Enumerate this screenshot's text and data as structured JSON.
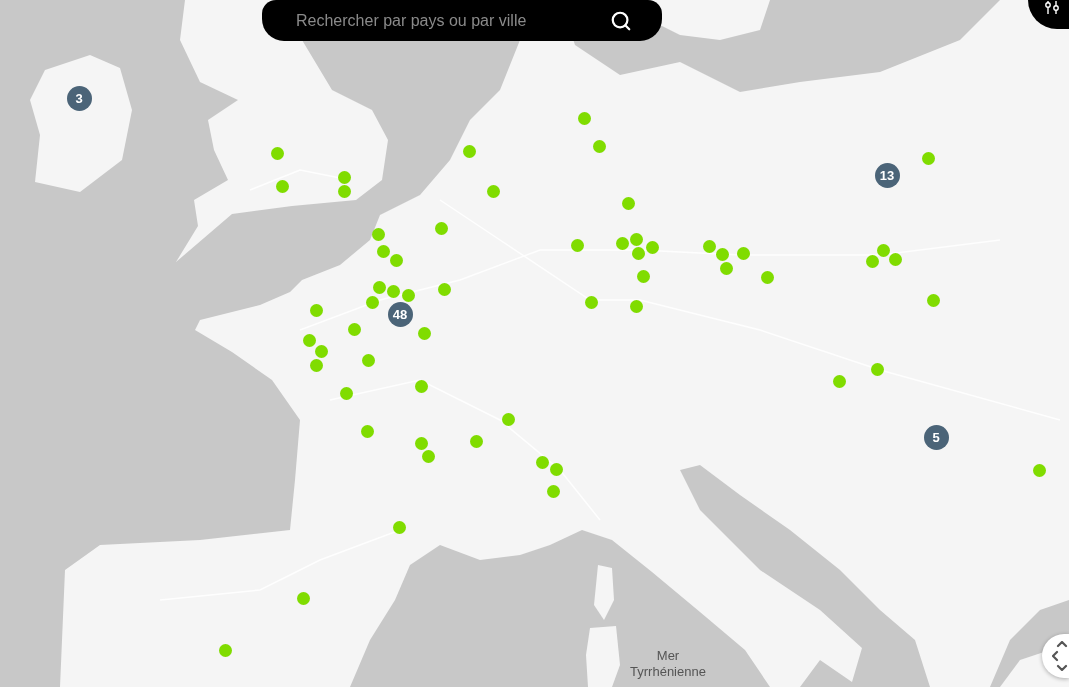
{
  "search": {
    "placeholder": "Rechercher par pays ou par ville"
  },
  "map": {
    "sea_label": "Mer Tyrrhénienne"
  },
  "markers": [
    {
      "kind": "cluster",
      "count": "3"
    },
    {
      "kind": "point"
    },
    {
      "kind": "point"
    },
    {
      "kind": "point"
    },
    {
      "kind": "point"
    },
    {
      "kind": "point"
    },
    {
      "kind": "cluster",
      "count": "13"
    },
    {
      "kind": "point"
    },
    {
      "kind": "point"
    },
    {
      "kind": "point"
    },
    {
      "kind": "point"
    },
    {
      "kind": "point"
    },
    {
      "kind": "point"
    },
    {
      "kind": "point"
    },
    {
      "kind": "point"
    },
    {
      "kind": "point"
    },
    {
      "kind": "point"
    },
    {
      "kind": "point"
    },
    {
      "kind": "point"
    },
    {
      "kind": "point"
    },
    {
      "kind": "point"
    },
    {
      "kind": "point"
    },
    {
      "kind": "point"
    },
    {
      "kind": "point"
    },
    {
      "kind": "point"
    },
    {
      "kind": "point"
    },
    {
      "kind": "point"
    },
    {
      "kind": "point"
    },
    {
      "kind": "point"
    },
    {
      "kind": "point"
    },
    {
      "kind": "point"
    },
    {
      "kind": "point"
    },
    {
      "kind": "point"
    },
    {
      "kind": "point"
    },
    {
      "kind": "point"
    },
    {
      "kind": "point"
    },
    {
      "kind": "point"
    },
    {
      "kind": "point"
    },
    {
      "kind": "point"
    },
    {
      "kind": "cluster",
      "count": "48"
    },
    {
      "kind": "point"
    },
    {
      "kind": "point"
    },
    {
      "kind": "point"
    },
    {
      "kind": "point"
    },
    {
      "kind": "point"
    },
    {
      "kind": "point"
    },
    {
      "kind": "point"
    },
    {
      "kind": "point"
    },
    {
      "kind": "point"
    },
    {
      "kind": "point"
    },
    {
      "kind": "point"
    },
    {
      "kind": "point"
    },
    {
      "kind": "cluster",
      "count": "5"
    },
    {
      "kind": "point"
    },
    {
      "kind": "point"
    },
    {
      "kind": "point"
    },
    {
      "kind": "point"
    },
    {
      "kind": "point"
    },
    {
      "kind": "point"
    },
    {
      "kind": "point"
    },
    {
      "kind": "point"
    },
    {
      "kind": "point"
    },
    {
      "kind": "point"
    }
  ]
}
